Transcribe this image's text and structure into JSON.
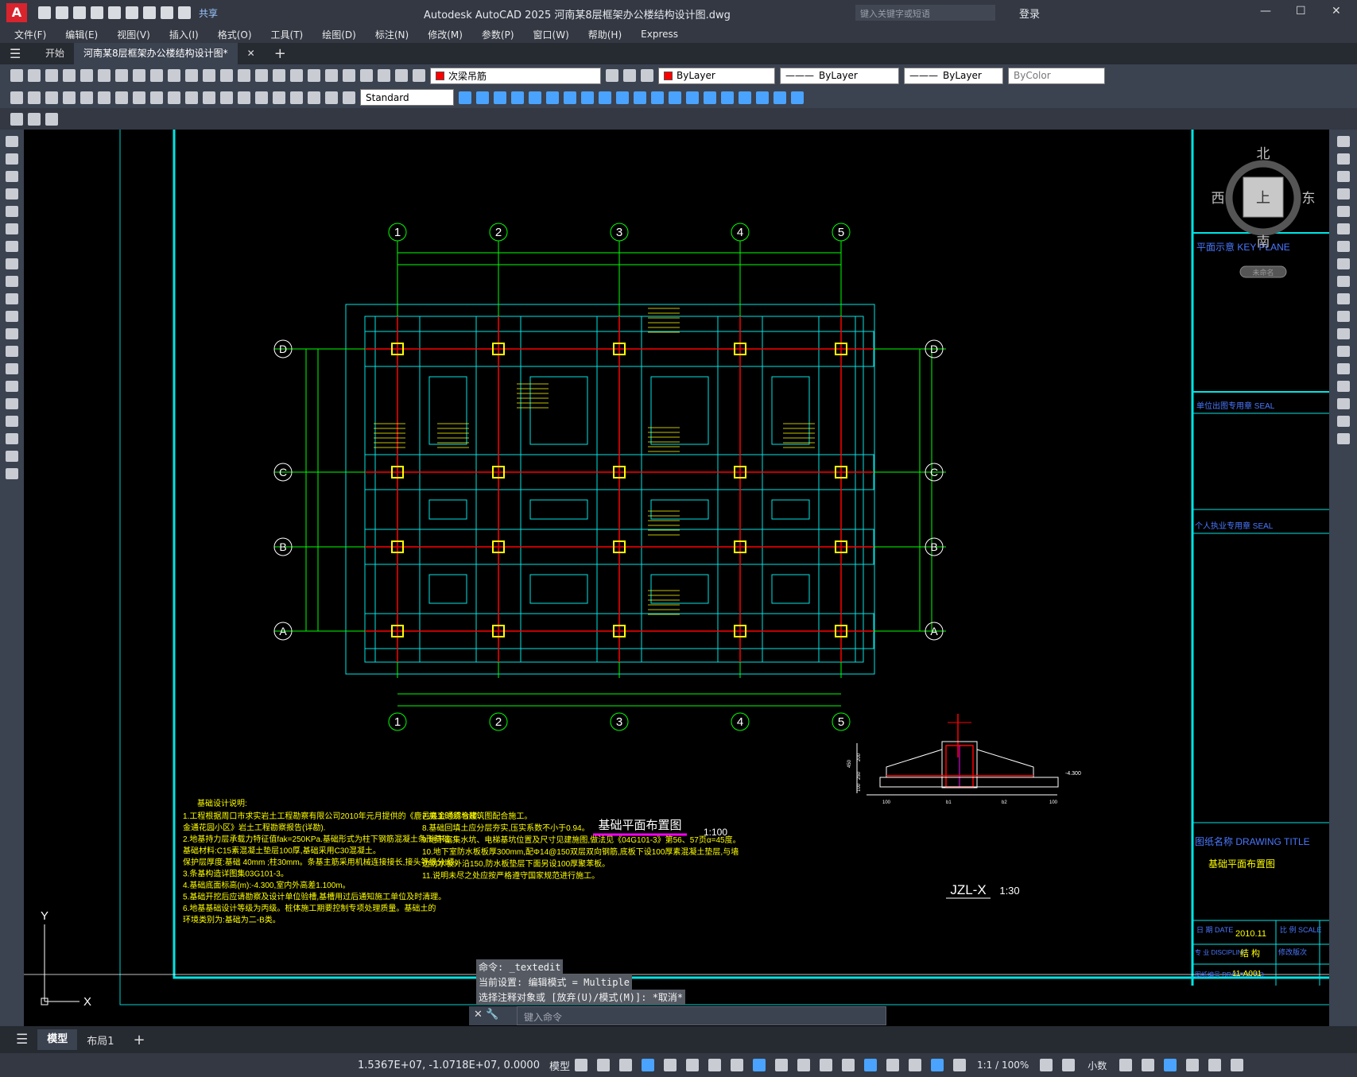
{
  "app": {
    "logo": "A",
    "title": "Autodesk AutoCAD 2025    河南某8层框架办公楼结构设计图.dwg",
    "share": "共享",
    "search_placeholder": "键入关键字或短语",
    "login": "登录"
  },
  "menu": [
    "文件(F)",
    "编辑(E)",
    "视图(V)",
    "插入(I)",
    "格式(O)",
    "工具(T)",
    "绘图(D)",
    "标注(N)",
    "修改(M)",
    "参数(P)",
    "窗口(W)",
    "帮助(H)",
    "Express"
  ],
  "tabs": {
    "start": "开始",
    "file": "河南某8层框架办公楼结构设计图*",
    "add": "+"
  },
  "toolbar": {
    "layer": "次梁吊筋",
    "layer_color": "#ff0000",
    "color": "ByLayer",
    "linetype": "ByLayer",
    "lineweight": "ByLayer",
    "plotstyle": "ByColor",
    "textstyle": "Standard"
  },
  "viewcube": {
    "north": "北",
    "south": "南",
    "east": "东",
    "west": "西",
    "face": "上",
    "ucs": "未命名"
  },
  "grid": {
    "cols": [
      "1",
      "2",
      "3",
      "4",
      "5"
    ],
    "rows": [
      "D",
      "C",
      "B",
      "A"
    ]
  },
  "plan_title": "基础平面布置图",
  "plan_scale": "1:100",
  "section_title": "JZL-X",
  "section_scale": "1:30",
  "section_dims": {
    "h1": "450",
    "h2": "200",
    "h3": "250",
    "h4": "100",
    "b1": "b1",
    "b2": "b2",
    "e1": "100",
    "e2": "100",
    "elev": "-4.300"
  },
  "notes_heading": "基础设计说明:",
  "notes_left": [
    "1.工程根据周口市求实岩土工程勘察有限公司2010年元月提供的《鹿邑县金通综合楼、",
    "   金通花园小区》岩土工程勘察报告(详勘).",
    "2.地基持力层承载力特征值fak=250KPa.基础形式为柱下钢筋混凝土条形基础。",
    "   基础材料:C15素混凝土垫层100厚,基础采用C30混凝土。",
    "   保护层厚度:基础 40mm ;柱30mm。条基主筋采用机械连接接长,接头等级分I级。",
    "3.条基构造详图集03G101-3。",
    "4.基础底面标高(m):-4.300,室内外高差1.100m。",
    "5.基础开挖后应请勘察及设计单位验槽,基槽用过后通知施工单位及时清理。",
    "6.地基基础设计等级为丙级。桩体施工期要控制专项处理质量。基础土的",
    "   环境类别为:基础为二-B类。"
  ],
  "notes_right": [
    "7.施工时须与建筑图配合施工。",
    "8.基础回填土应分层夯实,压实系数不小于0.94。",
    "9.地下室集水坑、电梯基坑位置及尺寸见建施图,做法见《04G101-3》第56、57页α=45度。",
    "10.地下室防水板板厚300mm,配Φ14@150双层双向钢筋,底板下设100厚素混凝土垫层,与墙",
    "   边防水板外沿150,防水板垫层下面另设100厚聚苯板。",
    "11.说明未尽之处应按严格遵守国家规范进行施工。"
  ],
  "titleblock": {
    "keyplan": "平面示意 KEY PLANE",
    "seal1": "单位出图专用章 SEAL",
    "seal2": "个人执业专用章 SEAL",
    "drawing_title_label": "图纸名称 DRAWING TITLE",
    "drawing_title": "基础平面布置图",
    "date_label": "日 期 DATE",
    "date": "2010.11",
    "scale_label": "比 例 SCALE",
    "disc_label": "专 业 DISCIPLINE",
    "disc": "结 构",
    "rev_label": "修改版次",
    "no_label": "图纸编号 DRAWING NO.",
    "no": "11-A001"
  },
  "command": {
    "line1": "命令: _textedit",
    "line2": "当前设置: 编辑模式 = Multiple",
    "line3": "选择注释对象或 [放弃(U)/模式(M)]: *取消*",
    "input_placeholder": "键入命令"
  },
  "ucs": {
    "x": "X",
    "y": "Y"
  },
  "layouts": [
    "模型",
    "布局1",
    "+"
  ],
  "status": {
    "coords": "1.5367E+07, -1.0718E+07, 0.0000",
    "model": "模型",
    "annoscale": "1:1 / 100%",
    "units": "小数"
  }
}
